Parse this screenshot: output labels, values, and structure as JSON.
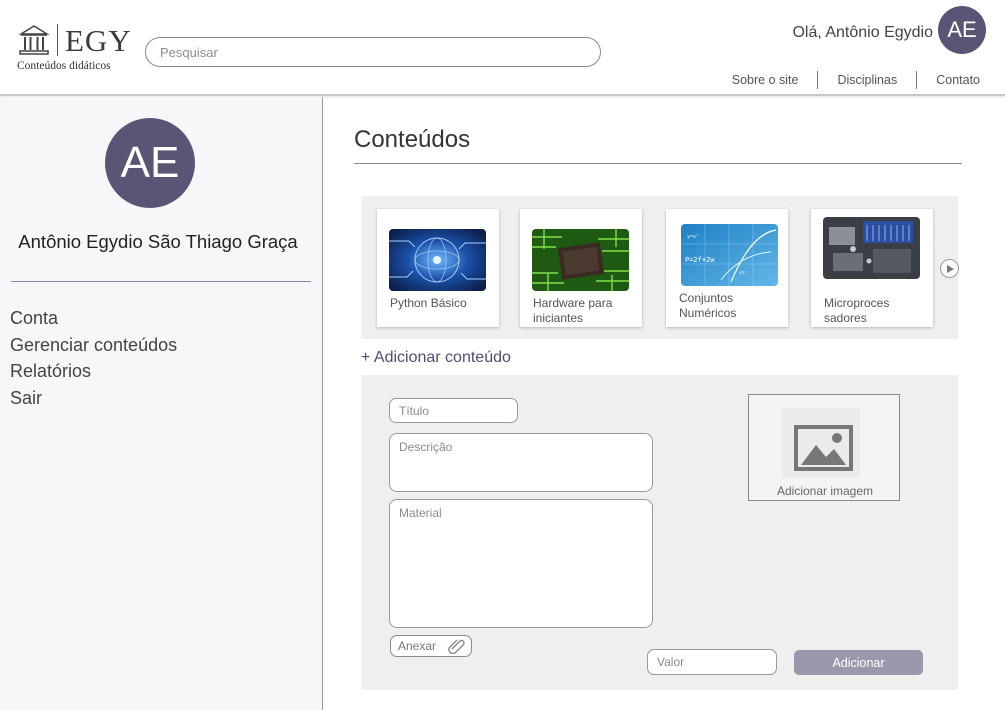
{
  "brand": {
    "name": "EGY",
    "tagline": "Conteúdos didáticos"
  },
  "search": {
    "placeholder": "Pesquisar"
  },
  "user": {
    "greeting": "Olá, Antônio Egydio",
    "initials": "AE",
    "full_name": "Antônio Egydio São Thiago Graça"
  },
  "topnav": {
    "items": [
      {
        "label": "Sobre o site"
      },
      {
        "label": "Disciplinas"
      },
      {
        "label": "Contato"
      }
    ]
  },
  "sidebar": {
    "items": [
      {
        "label": "Conta"
      },
      {
        "label": "Gerenciar conteúdos"
      },
      {
        "label": "Relatórios"
      },
      {
        "label": "Sair"
      }
    ]
  },
  "main": {
    "title": "Conteúdos",
    "cards": [
      {
        "label": "Python Básico",
        "image": "circuit-globe-image"
      },
      {
        "label": "Hardware para iniciantes",
        "image": "microchip-image"
      },
      {
        "label": "Conjuntos Numéricos",
        "image": "math-formulas-image"
      },
      {
        "label": "Microproces sadores",
        "image": "motherboard-image"
      }
    ],
    "add_content_label": "+ Adicionar conteúdo"
  },
  "form": {
    "title_placeholder": "Título",
    "description_placeholder": "Descrição",
    "material_placeholder": "Material",
    "image_label": "Adicionar imagem",
    "attach_label": "Anexar",
    "value_placeholder": "Valor",
    "submit_label": "Adicionar"
  },
  "colors": {
    "avatar": "#5b5575",
    "accent": "#4f4d75",
    "button": "#9b98ae"
  }
}
